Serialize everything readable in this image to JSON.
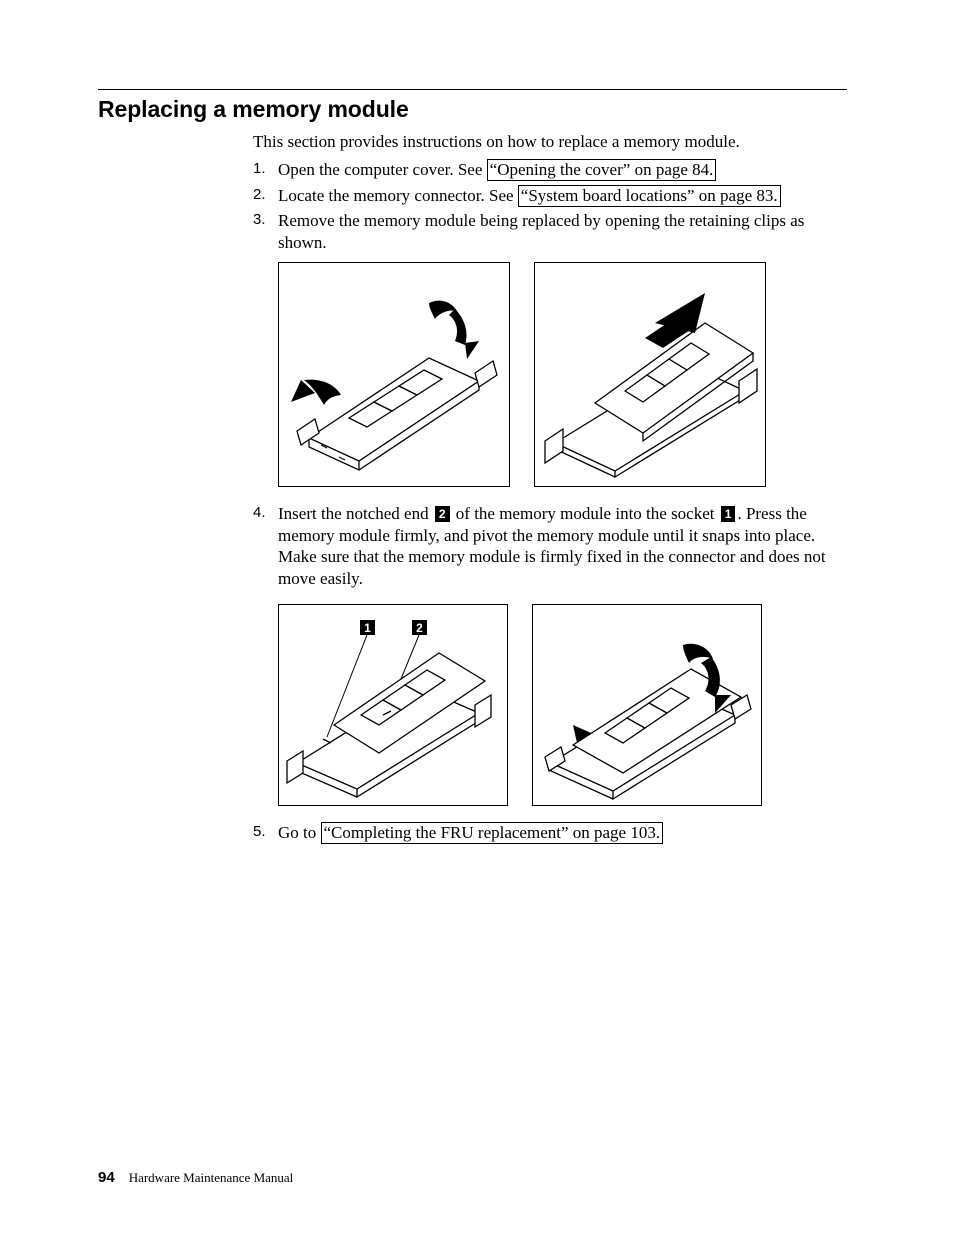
{
  "heading": "Replacing a memory module",
  "intro": "This section provides instructions on how to replace a memory module.",
  "steps": [
    {
      "num": "1.",
      "pre": "Open the computer cover. See ",
      "link": "“Opening the cover” on page 84."
    },
    {
      "num": "2.",
      "pre": "Locate the memory connector. See ",
      "link": "“System board locations” on page 83."
    },
    {
      "num": "3.",
      "text": "Remove the memory module being replaced by opening the retaining clips as shown."
    },
    {
      "num": "4.",
      "part1": "Insert the notched end ",
      "callout_a": "2",
      "part2": " of the memory module into the socket ",
      "callout_b": "1",
      "part3": ". Press the memory module firmly, and pivot the memory module until it snaps into place. Make sure that the memory module is firmly fixed in the connector and does not move easily."
    },
    {
      "num": "5.",
      "pre": "Go to ",
      "link": "“Completing the FRU replacement” on page 103."
    }
  ],
  "fig2_labels": {
    "a": "1",
    "b": "2"
  },
  "footer": {
    "pagenum": "94",
    "title": "Hardware Maintenance Manual"
  }
}
